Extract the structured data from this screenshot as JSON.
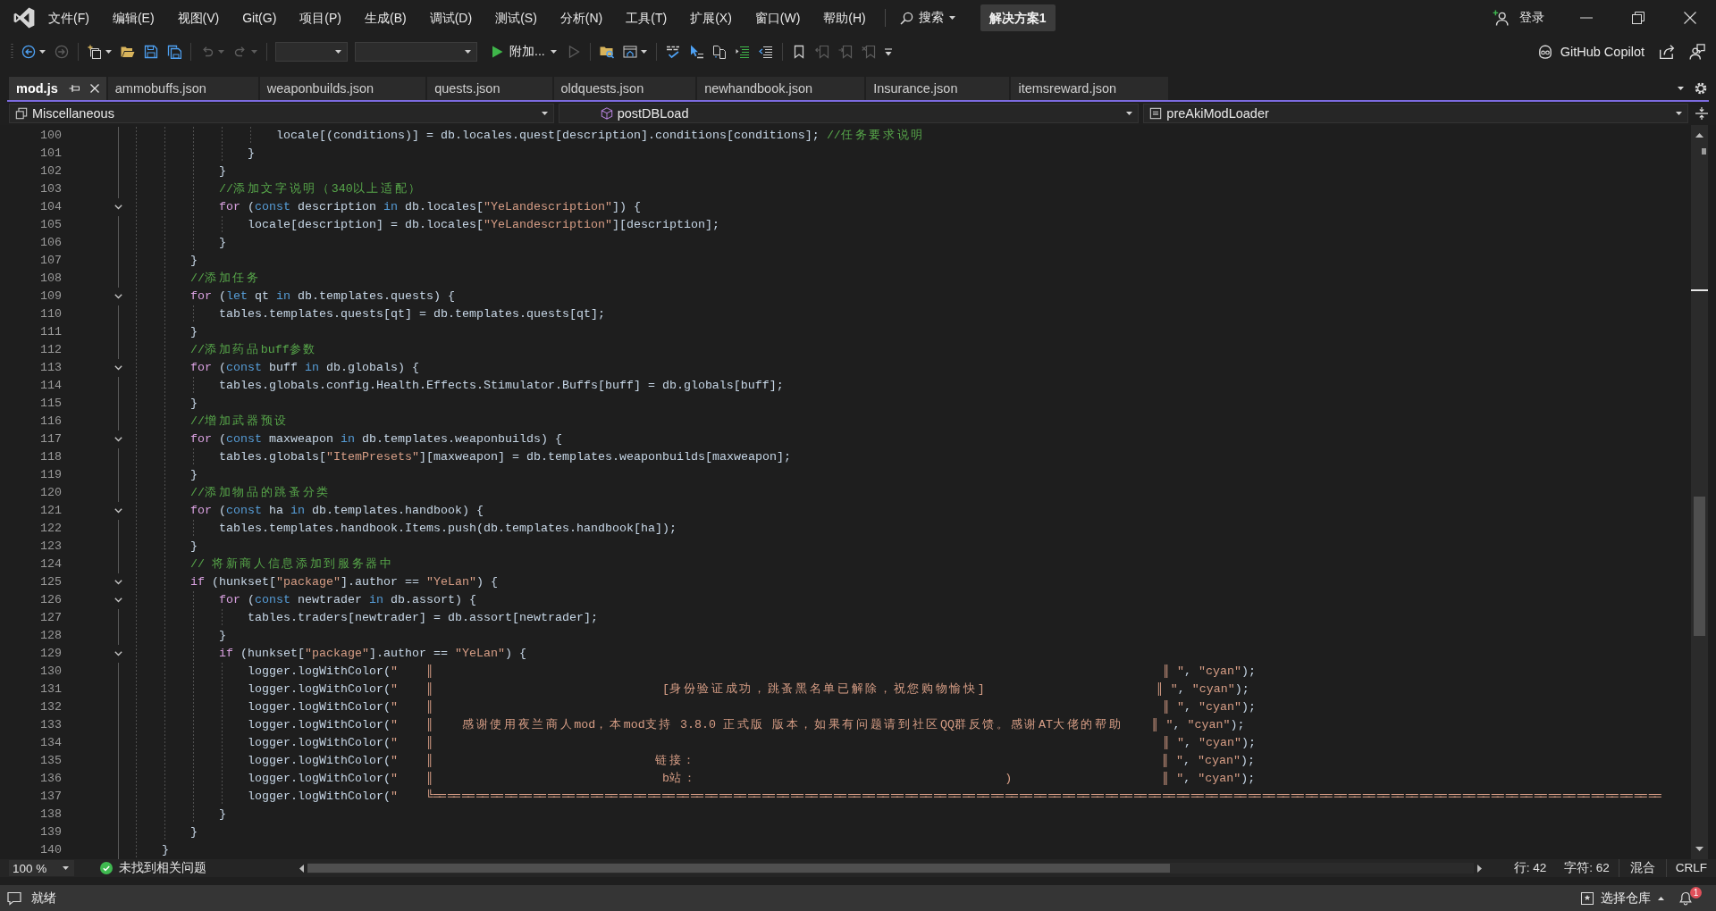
{
  "title_bar": {
    "menu": [
      "文件(F)",
      "编辑(E)",
      "视图(V)",
      "Git(G)",
      "项目(P)",
      "生成(B)",
      "调试(D)",
      "测试(S)",
      "分析(N)",
      "工具(T)",
      "扩展(X)",
      "窗口(W)",
      "帮助(H)"
    ],
    "search": "搜索",
    "solution": "解决方案1",
    "sign_in": "登录"
  },
  "toolbar": {
    "groups": [
      [
        {
          "kind": "back",
          "disabled": false
        },
        {
          "kind": "forward",
          "disabled": true
        }
      ],
      [
        {
          "kind": "newitem",
          "disabled": false
        },
        {
          "kind": "open",
          "disabled": false
        },
        {
          "kind": "save",
          "disabled": false
        },
        {
          "kind": "saveall",
          "disabled": false
        }
      ],
      [
        {
          "kind": "undo",
          "disabled": true
        },
        {
          "kind": "redo",
          "disabled": true
        }
      ],
      [
        {
          "kind": "combo",
          "disabled": false
        },
        {
          "kind": "combo",
          "disabled": false
        },
        {
          "kind": "start",
          "label": "附加...",
          "disabled": false
        },
        {
          "kind": "run",
          "disabled": true
        }
      ],
      [
        {
          "kind": "findfolder",
          "disabled": false
        },
        {
          "kind": "window",
          "disabled": false
        }
      ],
      [
        {
          "kind": "spell",
          "disabled": false
        },
        {
          "kind": "pointer",
          "disabled": false
        },
        {
          "kind": "copy",
          "disabled": false
        },
        {
          "kind": "indent",
          "disabled": false
        },
        {
          "kind": "outdent",
          "disabled": false
        }
      ],
      [
        {
          "kind": "bookmark",
          "disabled": false
        },
        {
          "kind": "bookprev",
          "disabled": true
        },
        {
          "kind": "booknext",
          "disabled": true
        },
        {
          "kind": "bookclear",
          "disabled": true
        },
        {
          "kind": "overflow",
          "disabled": false
        }
      ]
    ],
    "copilot": "GitHub Copilot"
  },
  "tabs": [
    {
      "label": "mod.js",
      "selected": true
    },
    {
      "label": "ammobuffs.json",
      "selected": false
    },
    {
      "label": "weaponbuilds.json",
      "selected": false
    },
    {
      "label": "quests.json",
      "selected": false
    },
    {
      "label": "oldquests.json",
      "selected": false
    },
    {
      "label": "newhandbook.json",
      "selected": false
    },
    {
      "label": "Insurance.json",
      "selected": false
    },
    {
      "label": "itemsreward.json",
      "selected": false
    }
  ],
  "navigation": {
    "project": "Miscellaneous",
    "type": "postDBLoad",
    "member": "preAkiModLoader"
  },
  "editor": {
    "lines": [
      {
        "number": "100",
        "foldable": false,
        "tokens": [
          {
            "text": "                    locale[(conditions)] = db.locales.quest[description].conditions[conditions]; ",
            "kind": "text"
          },
          {
            "text": "//任务要求说明",
            "kind": "comment"
          }
        ]
      },
      {
        "number": "101",
        "foldable": false,
        "tokens": [
          {
            "text": "                }",
            "kind": "text"
          }
        ]
      },
      {
        "number": "102",
        "foldable": false,
        "tokens": [
          {
            "text": "            }",
            "kind": "text"
          }
        ]
      },
      {
        "number": "103",
        "foldable": false,
        "tokens": [
          {
            "text": "            //添加文字说明（340以上适配）",
            "kind": "comment"
          }
        ]
      },
      {
        "number": "104",
        "foldable": true,
        "tokens": [
          {
            "text": "            for",
            "kind": "control"
          },
          {
            "text": " (",
            "kind": "text"
          },
          {
            "text": "const",
            "kind": "keyword"
          },
          {
            "text": " description ",
            "kind": "text"
          },
          {
            "text": "in",
            "kind": "keyword"
          },
          {
            "text": " db.locales[",
            "kind": "text"
          },
          {
            "text": "\"YeLandescription\"",
            "kind": "string"
          },
          {
            "text": "]) {",
            "kind": "text"
          }
        ]
      },
      {
        "number": "105",
        "foldable": false,
        "tokens": [
          {
            "text": "                locale[description] = db.locales[",
            "kind": "text"
          },
          {
            "text": "\"YeLandescription\"",
            "kind": "string"
          },
          {
            "text": "][description];",
            "kind": "text"
          }
        ]
      },
      {
        "number": "106",
        "foldable": false,
        "tokens": [
          {
            "text": "            }",
            "kind": "text"
          }
        ]
      },
      {
        "number": "107",
        "foldable": false,
        "tokens": [
          {
            "text": "        }",
            "kind": "text"
          }
        ]
      },
      {
        "number": "108",
        "foldable": false,
        "tokens": [
          {
            "text": "        //添加任务",
            "kind": "comment"
          }
        ]
      },
      {
        "number": "109",
        "foldable": true,
        "tokens": [
          {
            "text": "        for",
            "kind": "control"
          },
          {
            "text": " (",
            "kind": "text"
          },
          {
            "text": "let",
            "kind": "keyword"
          },
          {
            "text": " qt ",
            "kind": "text"
          },
          {
            "text": "in",
            "kind": "keyword"
          },
          {
            "text": " db.templates.quests) {",
            "kind": "text"
          }
        ]
      },
      {
        "number": "110",
        "foldable": false,
        "tokens": [
          {
            "text": "            tables.templates.quests[qt] = db.templates.quests[qt];",
            "kind": "text"
          }
        ]
      },
      {
        "number": "111",
        "foldable": false,
        "tokens": [
          {
            "text": "        }",
            "kind": "text"
          }
        ]
      },
      {
        "number": "112",
        "foldable": false,
        "tokens": [
          {
            "text": "        //添加药品buff参数",
            "kind": "comment"
          }
        ]
      },
      {
        "number": "113",
        "foldable": true,
        "tokens": [
          {
            "text": "        for",
            "kind": "control"
          },
          {
            "text": " (",
            "kind": "text"
          },
          {
            "text": "const",
            "kind": "keyword"
          },
          {
            "text": " buff ",
            "kind": "text"
          },
          {
            "text": "in",
            "kind": "keyword"
          },
          {
            "text": " db.globals) {",
            "kind": "text"
          }
        ]
      },
      {
        "number": "114",
        "foldable": false,
        "tokens": [
          {
            "text": "            tables.globals.config.Health.Effects.Stimulator.Buffs[buff] = db.globals[buff];",
            "kind": "text"
          }
        ]
      },
      {
        "number": "115",
        "foldable": false,
        "tokens": [
          {
            "text": "        }",
            "kind": "text"
          }
        ]
      },
      {
        "number": "116",
        "foldable": false,
        "tokens": [
          {
            "text": "        //增加武器预设",
            "kind": "comment"
          }
        ]
      },
      {
        "number": "117",
        "foldable": true,
        "tokens": [
          {
            "text": "        for",
            "kind": "control"
          },
          {
            "text": " (",
            "kind": "text"
          },
          {
            "text": "const",
            "kind": "keyword"
          },
          {
            "text": " maxweapon ",
            "kind": "text"
          },
          {
            "text": "in",
            "kind": "keyword"
          },
          {
            "text": " db.templates.weaponbuilds) {",
            "kind": "text"
          }
        ]
      },
      {
        "number": "118",
        "foldable": false,
        "tokens": [
          {
            "text": "            tables.globals[",
            "kind": "text"
          },
          {
            "text": "\"ItemPresets\"",
            "kind": "string"
          },
          {
            "text": "][maxweapon] = db.templates.weaponbuilds[maxweapon];",
            "kind": "text"
          }
        ]
      },
      {
        "number": "119",
        "foldable": false,
        "tokens": [
          {
            "text": "        }",
            "kind": "text"
          }
        ]
      },
      {
        "number": "120",
        "foldable": false,
        "tokens": [
          {
            "text": "        //添加物品的跳蚤分类",
            "kind": "comment"
          }
        ]
      },
      {
        "number": "121",
        "foldable": true,
        "tokens": [
          {
            "text": "        for",
            "kind": "control"
          },
          {
            "text": " (",
            "kind": "text"
          },
          {
            "text": "const",
            "kind": "keyword"
          },
          {
            "text": " ha ",
            "kind": "text"
          },
          {
            "text": "in",
            "kind": "keyword"
          },
          {
            "text": " db.templates.handbook) {",
            "kind": "text"
          }
        ]
      },
      {
        "number": "122",
        "foldable": false,
        "tokens": [
          {
            "text": "            tables.templates.handbook.Items.push(db.templates.handbook[ha]);",
            "kind": "text"
          }
        ]
      },
      {
        "number": "123",
        "foldable": false,
        "tokens": [
          {
            "text": "        }",
            "kind": "text"
          }
        ]
      },
      {
        "number": "124",
        "foldable": false,
        "tokens": [
          {
            "text": "        // 将新商人信息添加到服务器中",
            "kind": "comment"
          }
        ]
      },
      {
        "number": "125",
        "foldable": true,
        "tokens": [
          {
            "text": "        if",
            "kind": "control"
          },
          {
            "text": " (hunkset[",
            "kind": "text"
          },
          {
            "text": "\"package\"",
            "kind": "string"
          },
          {
            "text": "].author == ",
            "kind": "text"
          },
          {
            "text": "\"YeLan\"",
            "kind": "string"
          },
          {
            "text": ") {",
            "kind": "text"
          }
        ]
      },
      {
        "number": "126",
        "foldable": true,
        "tokens": [
          {
            "text": "            for",
            "kind": "control"
          },
          {
            "text": " (",
            "kind": "text"
          },
          {
            "text": "const",
            "kind": "keyword"
          },
          {
            "text": " newtrader ",
            "kind": "text"
          },
          {
            "text": "in",
            "kind": "keyword"
          },
          {
            "text": " db.assort) {",
            "kind": "text"
          }
        ]
      },
      {
        "number": "127",
        "foldable": false,
        "tokens": [
          {
            "text": "                tables.traders[newtrader] = db.assort[newtrader];",
            "kind": "text"
          }
        ]
      },
      {
        "number": "128",
        "foldable": false,
        "tokens": [
          {
            "text": "            }",
            "kind": "text"
          }
        ]
      },
      {
        "number": "129",
        "foldable": true,
        "tokens": [
          {
            "text": "            if",
            "kind": "control"
          },
          {
            "text": " (hunkset[",
            "kind": "text"
          },
          {
            "text": "\"package\"",
            "kind": "string"
          },
          {
            "text": "].author == ",
            "kind": "text"
          },
          {
            "text": "\"YeLan\"",
            "kind": "string"
          },
          {
            "text": ") {",
            "kind": "text"
          }
        ]
      },
      {
        "number": "130",
        "foldable": false,
        "tokens": [
          {
            "text": "                logger.logWithColor(",
            "kind": "text"
          },
          {
            "text": "\"    ║",
            "kind": "string"
          },
          {
            "text": "                                                                                                     ║\"",
            "kind": "string"
          },
          {
            "text": ", ",
            "kind": "text"
          },
          {
            "text": "\"cyan\"",
            "kind": "string"
          },
          {
            "text": ");",
            "kind": "text"
          }
        ]
      },
      {
        "number": "131",
        "foldable": false,
        "tokens": [
          {
            "text": "                logger.logWithColor(",
            "kind": "text"
          },
          {
            "text": "\"    ║",
            "kind": "string"
          },
          {
            "text": "                               [身份验证成功，跳蚤黑名单已解除，祝您购物愉快]",
            "kind": "string"
          },
          {
            "text": "                        ║\"",
            "kind": "string"
          },
          {
            "text": ", ",
            "kind": "text"
          },
          {
            "text": "\"cyan\"",
            "kind": "string"
          },
          {
            "text": ");",
            "kind": "text"
          }
        ]
      },
      {
        "number": "132",
        "foldable": false,
        "tokens": [
          {
            "text": "                logger.logWithColor(",
            "kind": "text"
          },
          {
            "text": "\"    ║",
            "kind": "string"
          },
          {
            "text": "                                                                                                     ║\"",
            "kind": "string"
          },
          {
            "text": ", ",
            "kind": "text"
          },
          {
            "text": "\"cyan\"",
            "kind": "string"
          },
          {
            "text": ");",
            "kind": "text"
          }
        ]
      },
      {
        "number": "133",
        "foldable": false,
        "tokens": [
          {
            "text": "                logger.logWithColor(",
            "kind": "text"
          },
          {
            "text": "\"    ║   感谢使用夜兰商人mod，本mod支持 3.8.0 正式版 版本，如果有问题请到社区QQ群反馈。感谢AT大佬的帮助    ║\"",
            "kind": "string"
          },
          {
            "text": ", ",
            "kind": "text"
          },
          {
            "text": "\"cyan\"",
            "kind": "string"
          },
          {
            "text": ");",
            "kind": "text"
          }
        ]
      },
      {
        "number": "134",
        "foldable": false,
        "tokens": [
          {
            "text": "                logger.logWithColor(",
            "kind": "text"
          },
          {
            "text": "\"    ║",
            "kind": "string"
          },
          {
            "text": "                                                                                                     ║\"",
            "kind": "string"
          },
          {
            "text": ", ",
            "kind": "text"
          },
          {
            "text": "\"cyan\"",
            "kind": "string"
          },
          {
            "text": ");",
            "kind": "text"
          }
        ]
      },
      {
        "number": "135",
        "foldable": false,
        "tokens": [
          {
            "text": "                logger.logWithColor(",
            "kind": "text"
          },
          {
            "text": "\"    ║",
            "kind": "string"
          },
          {
            "text": "                              链接：",
            "kind": "string"
          },
          {
            "text": "                                                                 ║\"",
            "kind": "string"
          },
          {
            "text": ", ",
            "kind": "text"
          },
          {
            "text": "\"cyan\"",
            "kind": "string"
          },
          {
            "text": ");",
            "kind": "text"
          }
        ]
      },
      {
        "number": "136",
        "foldable": false,
        "tokens": [
          {
            "text": "                logger.logWithColor(",
            "kind": "text"
          },
          {
            "text": "\"    ║",
            "kind": "string"
          },
          {
            "text": "                               b站：",
            "kind": "string"
          },
          {
            "text": "                                           )",
            "kind": "string"
          },
          {
            "text": "                     ║\"",
            "kind": "string"
          },
          {
            "text": ", ",
            "kind": "text"
          },
          {
            "text": "\"cyan\"",
            "kind": "string"
          },
          {
            "text": ");",
            "kind": "text"
          }
        ]
      },
      {
        "number": "137",
        "foldable": false,
        "tokens": [
          {
            "text": "                logger.logWithColor(",
            "kind": "text"
          },
          {
            "text": "\"    ╚══════════════════════════════════════════════════════════════════════════════════════",
            "kind": "string"
          }
        ]
      },
      {
        "number": "138",
        "foldable": false,
        "tokens": [
          {
            "text": "            }",
            "kind": "text"
          }
        ]
      },
      {
        "number": "139",
        "foldable": false,
        "tokens": [
          {
            "text": "        }",
            "kind": "text"
          }
        ]
      },
      {
        "number": "140",
        "foldable": false,
        "tokens": [
          {
            "text": "    }",
            "kind": "text"
          }
        ]
      }
    ],
    "zoom": "100 %",
    "issues": "未找到相关问题",
    "line": "行: 42",
    "column": "字符: 62",
    "whitespace": "混合",
    "line_ending": "CRLF"
  },
  "status_bar": {
    "message": "就绪",
    "repository": "选择仓库",
    "notifications": "1"
  }
}
